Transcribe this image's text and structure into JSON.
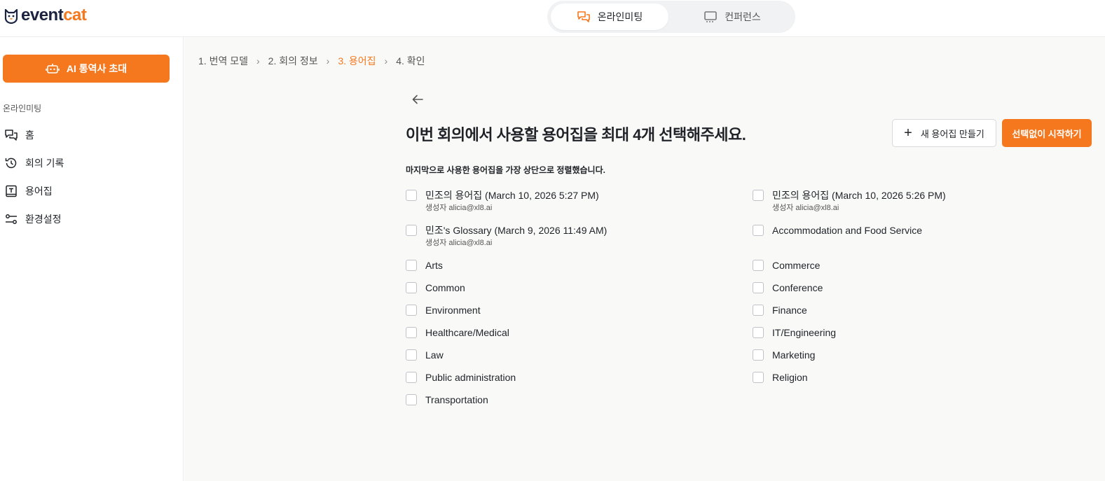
{
  "brand": {
    "name_part1": "event",
    "name_part2": "cat",
    "accent": "#f5781e"
  },
  "mode_switch": {
    "active": {
      "label": "온라인미팅",
      "icon": "chat-bubbles-icon"
    },
    "inactive": {
      "label": "컨퍼런스",
      "icon": "monitor-icon"
    }
  },
  "sidebar": {
    "ai_button": {
      "label": "AI 통역사 초대",
      "icon": "robot-icon"
    },
    "section_title": "온라인미팅",
    "items": [
      {
        "label": "홈",
        "icon": "chat-bubbles-icon"
      },
      {
        "label": "회의 기록",
        "icon": "history-icon"
      },
      {
        "label": "용어집",
        "icon": "glossary-book-icon"
      },
      {
        "label": "환경설정",
        "icon": "settings-sliders-icon"
      }
    ]
  },
  "breadcrumb": [
    {
      "label": "1. 번역 모델"
    },
    {
      "label": "2. 회의 정보"
    },
    {
      "label": "3. 용어집",
      "current": true
    },
    {
      "label": "4. 확인"
    }
  ],
  "main": {
    "heading": "이번 회의에서 사용할 용어집을 최대 4개 선택해주세요.",
    "subheading": "마지막으로 사용한 용어집을 가장 상단으로 정렬했습니다.",
    "new_button": "새 용어집 만들기",
    "start_button": "선택없이 시작하기"
  },
  "glossaries": [
    {
      "name": "민조의 용어집 (March 10, 2026 5:27 PM)",
      "creator": "생성자 alicia@xl8.ai",
      "checked": false
    },
    {
      "name": "민조의 용어집 (March 10, 2026 5:26 PM)",
      "creator": "생성자 alicia@xl8.ai",
      "checked": false
    },
    {
      "name": "민조's Glossary (March 9, 2026 11:49 AM)",
      "creator": "생성자 alicia@xl8.ai",
      "checked": false
    },
    {
      "name": "Accommodation and Food Service",
      "checked": false
    },
    {
      "name": "Arts",
      "checked": false
    },
    {
      "name": "Commerce",
      "checked": false
    },
    {
      "name": "Common",
      "checked": false
    },
    {
      "name": "Conference",
      "checked": false
    },
    {
      "name": "Environment",
      "checked": false
    },
    {
      "name": "Finance",
      "checked": false
    },
    {
      "name": "Healthcare/Medical",
      "checked": false
    },
    {
      "name": "IT/Engineering",
      "checked": false
    },
    {
      "name": "Law",
      "checked": false
    },
    {
      "name": "Marketing",
      "checked": false
    },
    {
      "name": "Public administration",
      "checked": false
    },
    {
      "name": "Religion",
      "checked": false
    },
    {
      "name": "Transportation",
      "checked": false
    }
  ]
}
